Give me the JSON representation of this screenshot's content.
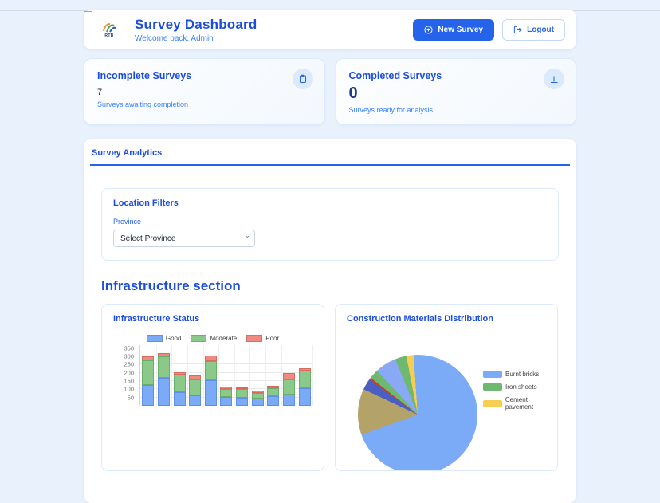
{
  "page": {
    "background": "#e9f1fc",
    "accent": "#1d4ed8"
  },
  "header": {
    "logo_text": "RTB",
    "title": "Survey Dashboard",
    "subtitle": "Welcome back, Admin",
    "new_survey_label": "New Survey",
    "logout_label": "Logout"
  },
  "stats": {
    "incomplete": {
      "title": "Incomplete Surveys",
      "value": "7",
      "subtitle": "Surveys awaiting completion",
      "icon": "clipboard-icon"
    },
    "completed": {
      "title": "Completed Surveys",
      "value": "0",
      "subtitle": "Surveys ready for analysis",
      "icon": "bar-chart-icon"
    }
  },
  "analytics": {
    "title": "Survey Analytics",
    "filters": {
      "title": "Location Filters",
      "province_label": "Province",
      "province_selected": "Select Province"
    },
    "section_heading": "Infrastructure section"
  },
  "chart_data": [
    {
      "type": "bar",
      "stacked": true,
      "title": "Infrastructure Status",
      "bar_count": 11,
      "series": [
        {
          "name": "Good",
          "color": "#7baaf7",
          "border": "#5e8fe8",
          "values": [
            128,
            168,
            80,
            65,
            155,
            55,
            48,
            42,
            58,
            68,
            108
          ]
        },
        {
          "name": "Moderate",
          "color": "#8bc98b",
          "border": "#69ad69",
          "values": [
            147,
            132,
            108,
            93,
            117,
            47,
            52,
            36,
            50,
            94,
            107
          ]
        },
        {
          "name": "Poor",
          "color": "#ee8a80",
          "border": "#d96a60",
          "values": [
            23,
            20,
            17,
            27,
            33,
            16,
            13,
            12,
            15,
            35,
            13
          ]
        }
      ],
      "y_ticks": [
        350,
        300,
        250,
        200,
        150,
        100,
        50
      ],
      "ylim": [
        0,
        368
      ],
      "legend_position": "top",
      "grid": true
    },
    {
      "type": "pie",
      "title": "Construction Materials Distribution",
      "legend_position": "right",
      "legend": [
        {
          "label": "Burnt bricks",
          "color": "#7baaf7"
        },
        {
          "label": "Iron sheets",
          "color": "#6fb86f"
        },
        {
          "label": "Cement pavement",
          "color": "#f5ce52"
        }
      ],
      "segments": [
        {
          "label": "Burnt bricks",
          "color": "#7baaf7",
          "start_deg": 356,
          "end_deg": 610
        },
        {
          "label": "olive-segment",
          "color": "#b3a369",
          "start_deg": 250,
          "end_deg": 295
        },
        {
          "label": "dark-blue-segment",
          "color": "#4a5fc1",
          "start_deg": 295,
          "end_deg": 306
        },
        {
          "label": "red-segment",
          "color": "#cc4125",
          "start_deg": 306,
          "end_deg": 308
        },
        {
          "label": "green-segment",
          "color": "#6fb86f",
          "start_deg": 308,
          "end_deg": 317
        },
        {
          "label": "light-blue-segment",
          "color": "#89a9f5",
          "start_deg": 317,
          "end_deg": 338
        },
        {
          "label": "green-segment-2",
          "color": "#6fb86f",
          "start_deg": 338,
          "end_deg": 349
        },
        {
          "label": "cement-pavement-segment",
          "color": "#f5ce52",
          "start_deg": 349,
          "end_deg": 356
        }
      ]
    }
  ]
}
